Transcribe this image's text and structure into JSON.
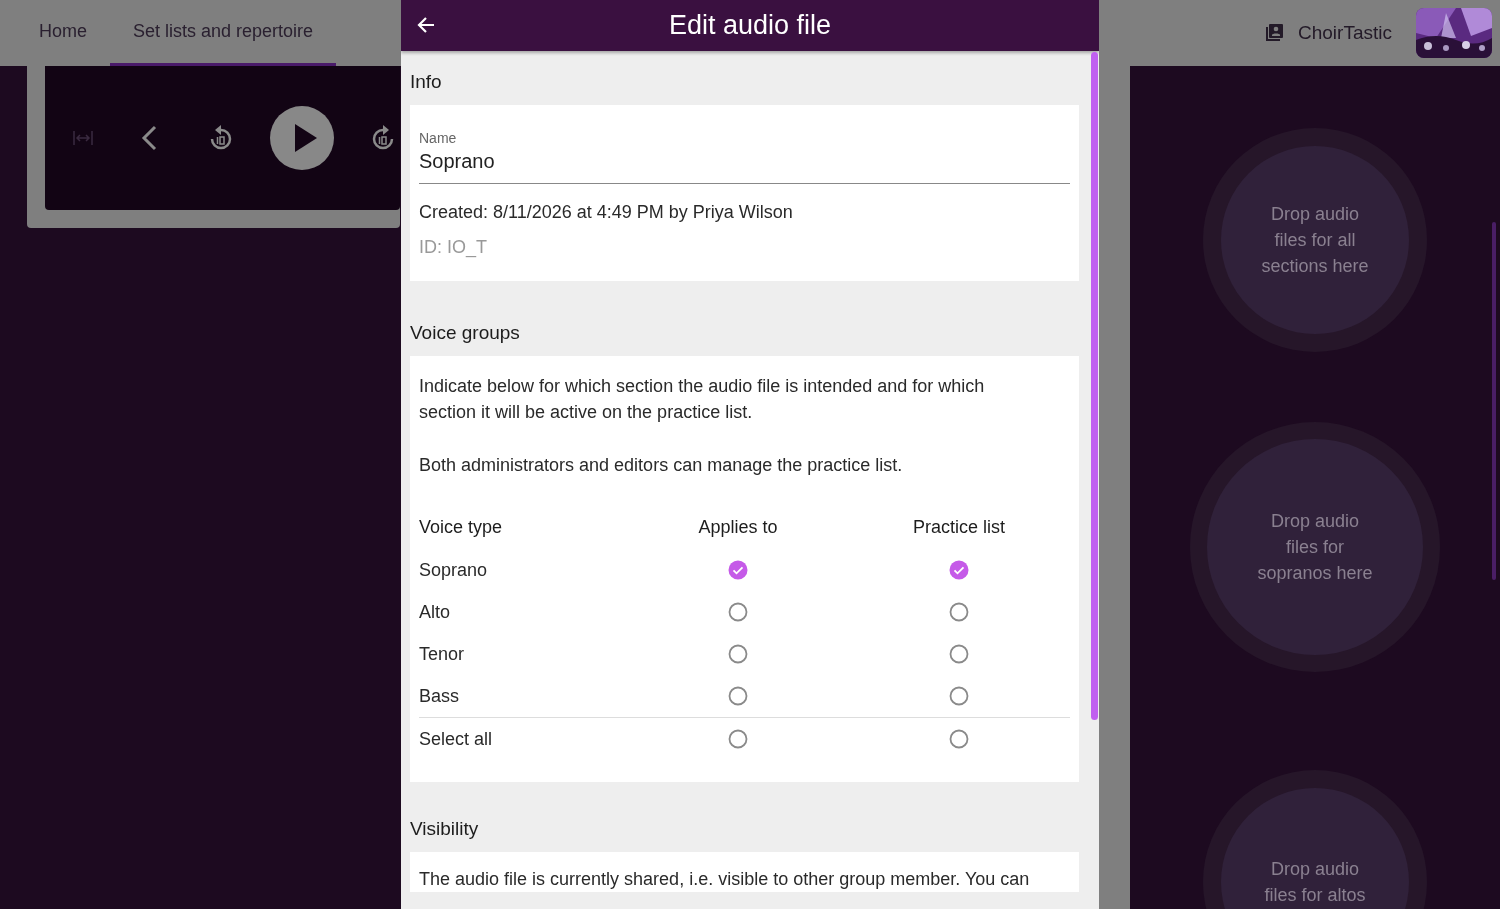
{
  "top_bar": {
    "tabs": [
      {
        "label": "Home",
        "selected": false
      },
      {
        "label": "Set lists and repertoire",
        "selected": true
      }
    ],
    "group_name": "ChoirTastic"
  },
  "drop_zones": [
    {
      "text": "Drop audio files for all sections here"
    },
    {
      "text": "Drop audio files for sopranos here"
    },
    {
      "text": "Drop audio files for altos"
    }
  ],
  "dialog": {
    "title": "Edit audio file",
    "info": {
      "heading": "Info",
      "name_label": "Name",
      "name_value": "Soprano",
      "created": "Created: 8/11/2026 at 4:49 PM by Priya Wilson",
      "id": "ID: IO_T"
    },
    "voice_groups": {
      "heading": "Voice groups",
      "description": [
        "Indicate below for which section the audio file is intended and for which section it will be active on the practice list.",
        "Both administrators and editors can manage the practice list."
      ],
      "columns": [
        "Voice type",
        "Applies to",
        "Practice list"
      ],
      "rows": [
        {
          "label": "Soprano",
          "applies": true,
          "practice": true
        },
        {
          "label": "Alto",
          "applies": false,
          "practice": false
        },
        {
          "label": "Tenor",
          "applies": false,
          "practice": false
        },
        {
          "label": "Bass",
          "applies": false,
          "practice": false
        }
      ],
      "select_all": {
        "label": "Select all",
        "applies": false,
        "practice": false
      }
    },
    "visibility": {
      "heading": "Visibility",
      "text": "The audio file is currently shared, i.e. visible to other group member. You can"
    }
  }
}
